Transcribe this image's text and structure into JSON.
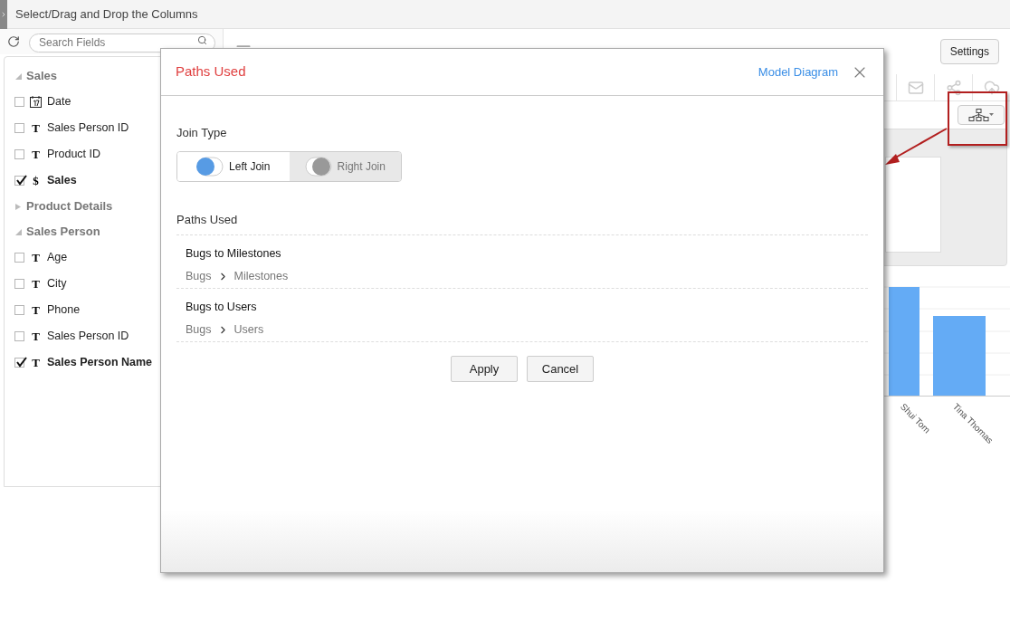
{
  "sidebar": {
    "title": "Select/Drag and Drop the Columns",
    "search": {
      "placeholder": "Search Fields"
    },
    "groups": [
      {
        "name": "Sales",
        "expanded": true,
        "children": [
          {
            "name": "Date",
            "kind": "date",
            "checked": false
          },
          {
            "name": "Sales Person ID",
            "kind": "glyph",
            "glyph": "T",
            "checked": false
          },
          {
            "name": "Product ID",
            "kind": "glyph",
            "glyph": "T",
            "checked": false
          },
          {
            "name": "Sales",
            "kind": "glyph",
            "glyph": "$",
            "checked": true
          }
        ]
      },
      {
        "name": "Product Details",
        "expanded": false
      },
      {
        "name": "Sales Person",
        "expanded": true,
        "children": [
          {
            "name": "Age",
            "kind": "glyph",
            "glyph": "T",
            "checked": false
          },
          {
            "name": "City",
            "kind": "glyph",
            "glyph": "T",
            "checked": false
          },
          {
            "name": "Phone",
            "kind": "glyph",
            "glyph": "T",
            "checked": false
          },
          {
            "name": "Sales Person ID",
            "kind": "glyph",
            "glyph": "T",
            "checked": false
          },
          {
            "name": "Sales Person Name",
            "kind": "glyph",
            "glyph": "T",
            "checked": true
          }
        ]
      }
    ]
  },
  "toolbar": {
    "settings": "Settings"
  },
  "chart": {
    "labels": [
      "Shui Tom",
      "Tina Thomas"
    ]
  },
  "dialog": {
    "title": "Paths Used",
    "link": "Model Diagram",
    "join_type": {
      "label": "Join Type",
      "options": [
        {
          "label": "Left Join",
          "selected": true
        },
        {
          "label": "Right Join",
          "selected": false
        }
      ]
    },
    "paths_heading": "Paths Used",
    "paths": [
      {
        "name": "Bugs to Milestones",
        "from": "Bugs",
        "to": "Milestones"
      },
      {
        "name": "Bugs to Users",
        "from": "Bugs",
        "to": "Users"
      }
    ],
    "buttons": [
      "Apply",
      "Cancel"
    ]
  }
}
